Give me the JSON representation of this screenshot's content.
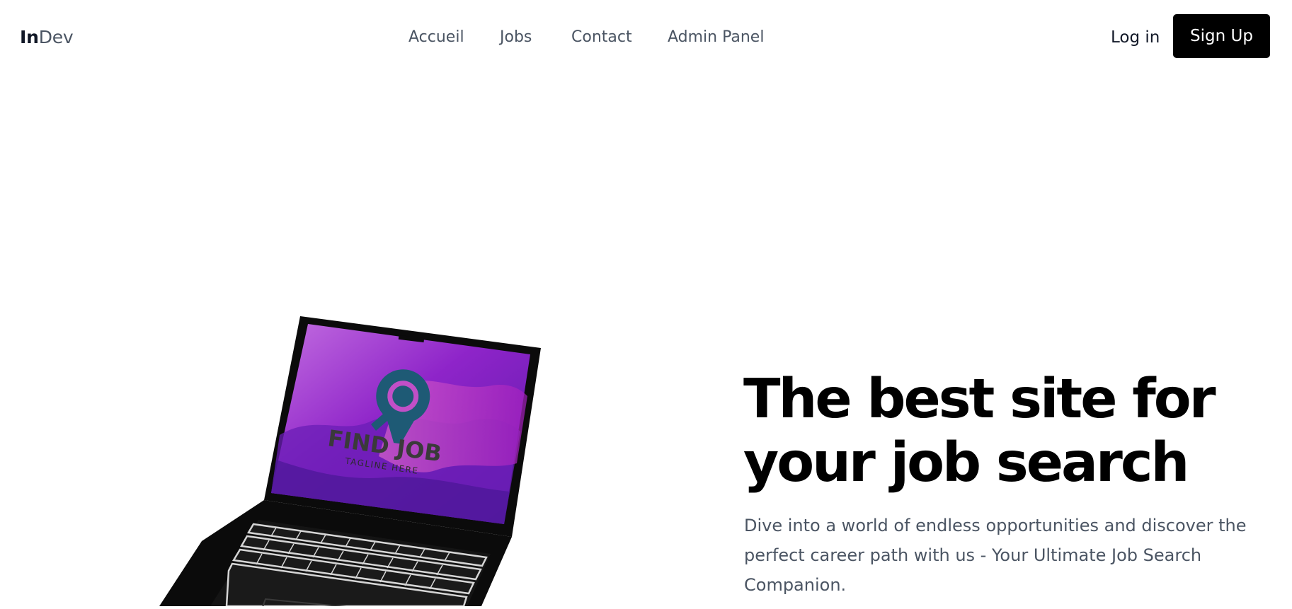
{
  "header": {
    "logo": {
      "strong": "In",
      "light": "Dev"
    },
    "nav": [
      {
        "label": "Accueil"
      },
      {
        "label": "Jobs"
      },
      {
        "label": "Contact"
      },
      {
        "label": "Admin Panel"
      }
    ],
    "login_label": "Log in",
    "signup_label": "Sign Up"
  },
  "hero": {
    "title_line1": "The best site for",
    "title_line2": "your job search",
    "subtitle": "Dive into a world of endless opportunities and discover the perfect career path with us - Your Ultimate Job Search Companion.",
    "image": {
      "screen_logo_text": "FIND JOB",
      "screen_tagline": "TAGLINE HERE",
      "icon": "location-search-pin-icon"
    }
  },
  "colors": {
    "text_dark": "#111827",
    "text_muted": "#4b5563",
    "button_bg": "#000000",
    "button_text": "#ffffff",
    "screen_purple": "#8e24c9",
    "screen_pink": "#c14fc7",
    "logo_teal": "#1e5a75"
  }
}
